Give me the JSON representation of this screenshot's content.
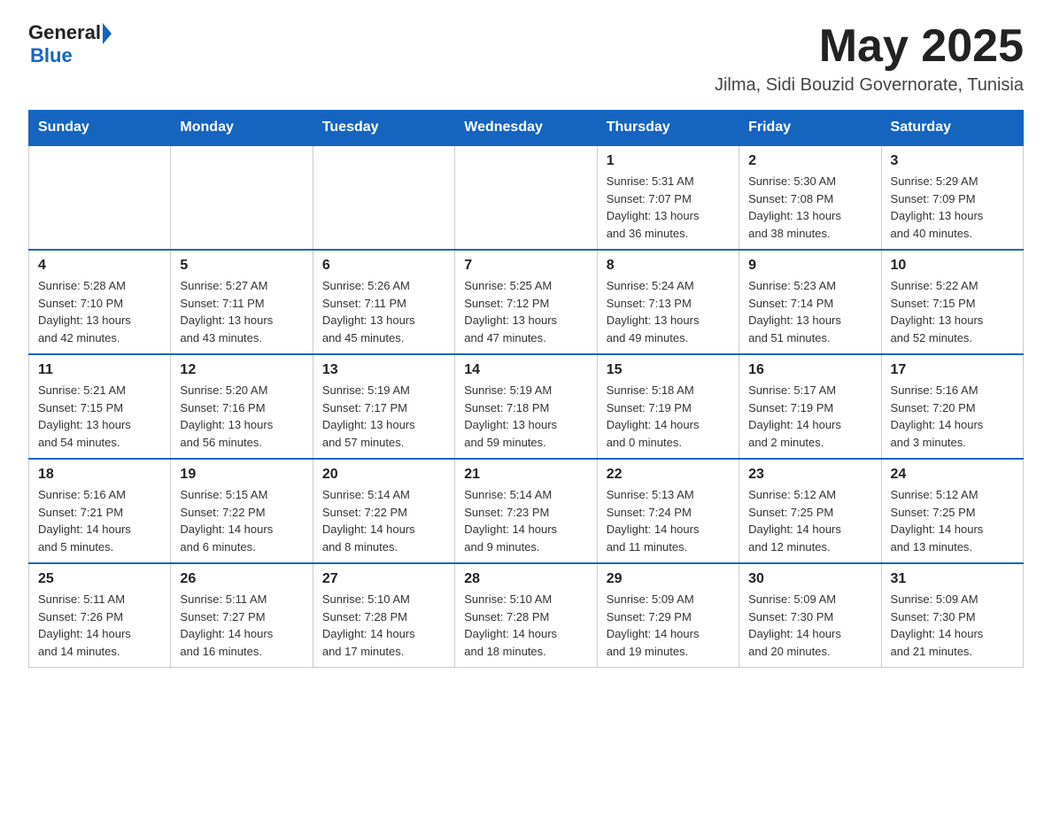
{
  "header": {
    "logo_general": "General",
    "logo_blue": "Blue",
    "month_title": "May 2025",
    "location": "Jilma, Sidi Bouzid Governorate, Tunisia"
  },
  "weekdays": [
    "Sunday",
    "Monday",
    "Tuesday",
    "Wednesday",
    "Thursday",
    "Friday",
    "Saturday"
  ],
  "weeks": [
    [
      {
        "day": "",
        "info": ""
      },
      {
        "day": "",
        "info": ""
      },
      {
        "day": "",
        "info": ""
      },
      {
        "day": "",
        "info": ""
      },
      {
        "day": "1",
        "info": "Sunrise: 5:31 AM\nSunset: 7:07 PM\nDaylight: 13 hours\nand 36 minutes."
      },
      {
        "day": "2",
        "info": "Sunrise: 5:30 AM\nSunset: 7:08 PM\nDaylight: 13 hours\nand 38 minutes."
      },
      {
        "day": "3",
        "info": "Sunrise: 5:29 AM\nSunset: 7:09 PM\nDaylight: 13 hours\nand 40 minutes."
      }
    ],
    [
      {
        "day": "4",
        "info": "Sunrise: 5:28 AM\nSunset: 7:10 PM\nDaylight: 13 hours\nand 42 minutes."
      },
      {
        "day": "5",
        "info": "Sunrise: 5:27 AM\nSunset: 7:11 PM\nDaylight: 13 hours\nand 43 minutes."
      },
      {
        "day": "6",
        "info": "Sunrise: 5:26 AM\nSunset: 7:11 PM\nDaylight: 13 hours\nand 45 minutes."
      },
      {
        "day": "7",
        "info": "Sunrise: 5:25 AM\nSunset: 7:12 PM\nDaylight: 13 hours\nand 47 minutes."
      },
      {
        "day": "8",
        "info": "Sunrise: 5:24 AM\nSunset: 7:13 PM\nDaylight: 13 hours\nand 49 minutes."
      },
      {
        "day": "9",
        "info": "Sunrise: 5:23 AM\nSunset: 7:14 PM\nDaylight: 13 hours\nand 51 minutes."
      },
      {
        "day": "10",
        "info": "Sunrise: 5:22 AM\nSunset: 7:15 PM\nDaylight: 13 hours\nand 52 minutes."
      }
    ],
    [
      {
        "day": "11",
        "info": "Sunrise: 5:21 AM\nSunset: 7:15 PM\nDaylight: 13 hours\nand 54 minutes."
      },
      {
        "day": "12",
        "info": "Sunrise: 5:20 AM\nSunset: 7:16 PM\nDaylight: 13 hours\nand 56 minutes."
      },
      {
        "day": "13",
        "info": "Sunrise: 5:19 AM\nSunset: 7:17 PM\nDaylight: 13 hours\nand 57 minutes."
      },
      {
        "day": "14",
        "info": "Sunrise: 5:19 AM\nSunset: 7:18 PM\nDaylight: 13 hours\nand 59 minutes."
      },
      {
        "day": "15",
        "info": "Sunrise: 5:18 AM\nSunset: 7:19 PM\nDaylight: 14 hours\nand 0 minutes."
      },
      {
        "day": "16",
        "info": "Sunrise: 5:17 AM\nSunset: 7:19 PM\nDaylight: 14 hours\nand 2 minutes."
      },
      {
        "day": "17",
        "info": "Sunrise: 5:16 AM\nSunset: 7:20 PM\nDaylight: 14 hours\nand 3 minutes."
      }
    ],
    [
      {
        "day": "18",
        "info": "Sunrise: 5:16 AM\nSunset: 7:21 PM\nDaylight: 14 hours\nand 5 minutes."
      },
      {
        "day": "19",
        "info": "Sunrise: 5:15 AM\nSunset: 7:22 PM\nDaylight: 14 hours\nand 6 minutes."
      },
      {
        "day": "20",
        "info": "Sunrise: 5:14 AM\nSunset: 7:22 PM\nDaylight: 14 hours\nand 8 minutes."
      },
      {
        "day": "21",
        "info": "Sunrise: 5:14 AM\nSunset: 7:23 PM\nDaylight: 14 hours\nand 9 minutes."
      },
      {
        "day": "22",
        "info": "Sunrise: 5:13 AM\nSunset: 7:24 PM\nDaylight: 14 hours\nand 11 minutes."
      },
      {
        "day": "23",
        "info": "Sunrise: 5:12 AM\nSunset: 7:25 PM\nDaylight: 14 hours\nand 12 minutes."
      },
      {
        "day": "24",
        "info": "Sunrise: 5:12 AM\nSunset: 7:25 PM\nDaylight: 14 hours\nand 13 minutes."
      }
    ],
    [
      {
        "day": "25",
        "info": "Sunrise: 5:11 AM\nSunset: 7:26 PM\nDaylight: 14 hours\nand 14 minutes."
      },
      {
        "day": "26",
        "info": "Sunrise: 5:11 AM\nSunset: 7:27 PM\nDaylight: 14 hours\nand 16 minutes."
      },
      {
        "day": "27",
        "info": "Sunrise: 5:10 AM\nSunset: 7:28 PM\nDaylight: 14 hours\nand 17 minutes."
      },
      {
        "day": "28",
        "info": "Sunrise: 5:10 AM\nSunset: 7:28 PM\nDaylight: 14 hours\nand 18 minutes."
      },
      {
        "day": "29",
        "info": "Sunrise: 5:09 AM\nSunset: 7:29 PM\nDaylight: 14 hours\nand 19 minutes."
      },
      {
        "day": "30",
        "info": "Sunrise: 5:09 AM\nSunset: 7:30 PM\nDaylight: 14 hours\nand 20 minutes."
      },
      {
        "day": "31",
        "info": "Sunrise: 5:09 AM\nSunset: 7:30 PM\nDaylight: 14 hours\nand 21 minutes."
      }
    ]
  ]
}
